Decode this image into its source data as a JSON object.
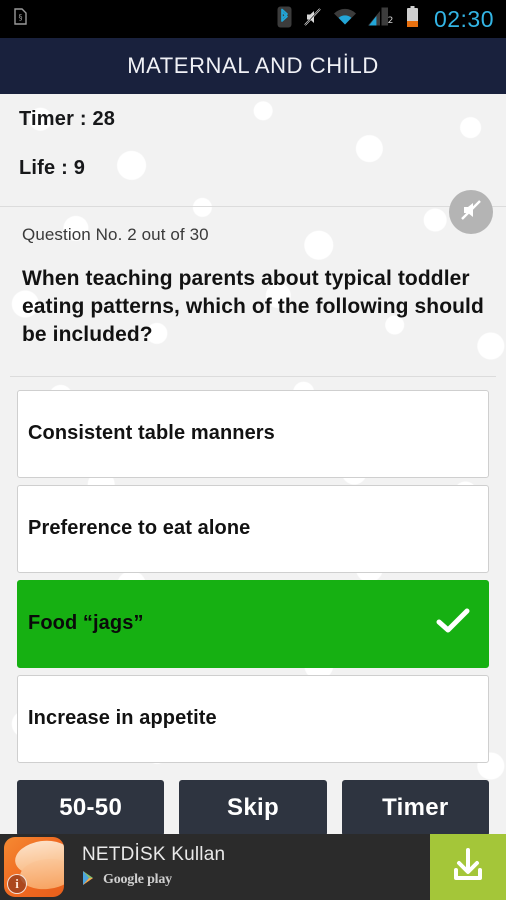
{
  "status_bar": {
    "clock": "02:30",
    "clock_color": "#33b5e5",
    "background": "#000000",
    "left_icons": [
      "sim-card-icon"
    ],
    "right_icons": [
      "bluetooth-icon",
      "silent-mode-icon",
      "wifi-icon",
      "cellular-signal-icon",
      "battery-icon"
    ]
  },
  "title_bar": {
    "title": "MATERNAL AND CHİLD",
    "background": "#19213d",
    "text_color": "#f0f1f6"
  },
  "stats": {
    "timer_label": "Timer  : 28",
    "life_label": "Life : 9",
    "mute_icon": "speaker-mute-icon",
    "mute_button_color": "#b4b4b4"
  },
  "question": {
    "counter": "Question No. 2 out of 30",
    "text": "When teaching parents about typical toddler eating patterns, which of the following should be included?"
  },
  "options": [
    {
      "label": "Consistent table manners",
      "selected": false
    },
    {
      "label": "Preference to eat alone",
      "selected": false
    },
    {
      "label": "Food “jags”",
      "selected": true
    },
    {
      "label": "Increase in appetite",
      "selected": false
    }
  ],
  "option_colors": {
    "selected_background": "#16b012",
    "default_background": "#ffffff",
    "border": "#cfcfcf",
    "check_color": "#ffffff"
  },
  "lifelines": [
    {
      "label": "50-50"
    },
    {
      "label": "Skip"
    },
    {
      "label": "Timer"
    }
  ],
  "lifeline_color": "#2e3440",
  "ad": {
    "headline": "NETDİSK Kullan",
    "store_label": "Google play",
    "store_icon": "google-play-icon",
    "app_icon": "netdisk-app-icon",
    "info_badge": "i",
    "cta_icon": "download-icon",
    "cta_color": "#a4c639",
    "background": "#2b2b2b"
  }
}
